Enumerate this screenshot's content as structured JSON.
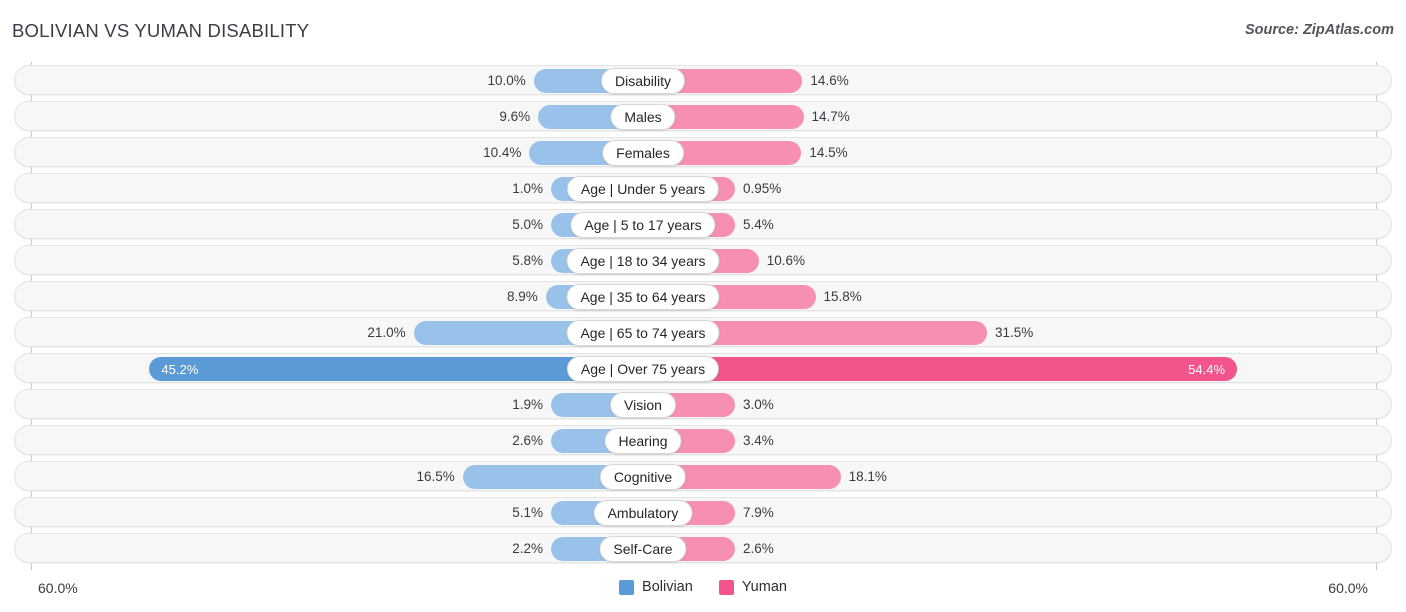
{
  "header": {
    "title": "BOLIVIAN VS YUMAN DISABILITY",
    "source": "Source: ZipAtlas.com"
  },
  "legend": {
    "items": [
      {
        "label": "Bolivian",
        "color": "#5b9bd5"
      },
      {
        "label": "Yuman",
        "color": "#f1558c"
      }
    ]
  },
  "axis": {
    "left_tick": "60.0%",
    "right_tick": "60.0%",
    "max": 60.0
  },
  "chart_data": {
    "type": "bar",
    "orientation": "horizontal-diverging",
    "title": "BOLIVIAN VS YUMAN DISABILITY",
    "xlabel": "",
    "ylabel": "",
    "xlim": [
      -60.0,
      60.0
    ],
    "grid": false,
    "legend_position": "bottom-center",
    "categories": [
      "Disability",
      "Males",
      "Females",
      "Age | Under 5 years",
      "Age | 5 to 17 years",
      "Age | 18 to 34 years",
      "Age | 35 to 64 years",
      "Age | 65 to 74 years",
      "Age | Over 75 years",
      "Vision",
      "Hearing",
      "Cognitive",
      "Ambulatory",
      "Self-Care"
    ],
    "series": [
      {
        "name": "Bolivian",
        "color": "#99c2ea",
        "highlight_color": "#5b9bd5",
        "values": [
          10.0,
          9.6,
          10.4,
          1.0,
          5.0,
          5.8,
          8.9,
          21.0,
          45.2,
          1.9,
          2.6,
          16.5,
          5.1,
          2.2
        ],
        "labels": [
          "10.0%",
          "9.6%",
          "10.4%",
          "1.0%",
          "5.0%",
          "5.8%",
          "8.9%",
          "21.0%",
          "45.2%",
          "1.9%",
          "2.6%",
          "16.5%",
          "5.1%",
          "2.2%"
        ]
      },
      {
        "name": "Yuman",
        "color": "#f78fb3",
        "highlight_color": "#f1558c",
        "values": [
          14.6,
          14.7,
          14.5,
          0.95,
          5.4,
          10.6,
          15.8,
          31.5,
          54.4,
          3.0,
          3.4,
          18.1,
          7.9,
          2.6
        ],
        "labels": [
          "14.6%",
          "14.7%",
          "14.5%",
          "0.95%",
          "5.4%",
          "10.6%",
          "15.8%",
          "31.5%",
          "54.4%",
          "3.0%",
          "3.4%",
          "18.1%",
          "7.9%",
          "2.6%"
        ]
      }
    ],
    "highlight_row": "Age | Over 75 years"
  }
}
